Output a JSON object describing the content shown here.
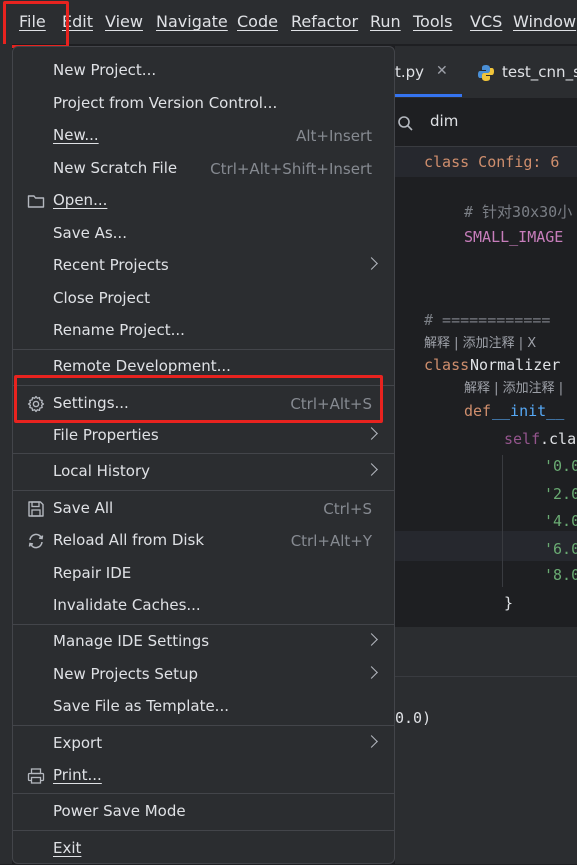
{
  "menubar": {
    "items": [
      "File",
      "Edit",
      "View",
      "Navigate",
      "Code",
      "Refactor",
      "Run",
      "Tools",
      "VCS",
      "Window"
    ]
  },
  "editor": {
    "tabs": [
      "t.py",
      "test_cnn_s"
    ],
    "search_text": "dim",
    "sticky_code": "class Config:  6",
    "comment_line": "# 针对30x30小",
    "small_image": "SMALL_IMAGE",
    "separator_comment": "# ============",
    "hint1": "解释 | 添加注释 | X",
    "class_line_kw": "class",
    "class_line_name": " Normalizer",
    "hint2": "解释 | 添加注释 |",
    "def_kw": "def",
    "def_name": " __init__",
    "self_line_self": "self",
    "self_line_rest": ".cla",
    "values": [
      "'0.0",
      "'2.0",
      "'4.0",
      "'6.0",
      "'8.0"
    ],
    "brace": "}",
    "bottom_text": "0.0)"
  },
  "menu": {
    "new_project": "New Project...",
    "from_vcs": "Project from Version Control...",
    "new": "New...",
    "new_shortcut": "Alt+Insert",
    "scratch": "New Scratch File",
    "scratch_shortcut": "Ctrl+Alt+Shift+Insert",
    "open": "Open...",
    "save_as": "Save As...",
    "recent": "Recent Projects",
    "close": "Close Project",
    "rename": "Rename Project...",
    "remote": "Remote Development...",
    "settings": "Settings...",
    "settings_shortcut": "Ctrl+Alt+S",
    "file_props": "File Properties",
    "local_history": "Local History",
    "save_all": "Save All",
    "save_all_shortcut": "Ctrl+S",
    "reload": "Reload All from Disk",
    "reload_shortcut": "Ctrl+Alt+Y",
    "repair": "Repair IDE",
    "invalidate": "Invalidate Caches...",
    "manage": "Manage IDE Settings",
    "new_setup": "New Projects Setup",
    "save_template": "Save File as Template...",
    "export": "Export",
    "print": "Print...",
    "power_save": "Power Save Mode",
    "exit": "Exit"
  },
  "colors": {
    "highlight_box": "#e8231f",
    "keyword": "#cf8e6d",
    "string": "#6aab73",
    "comment": "#7a7e85"
  }
}
